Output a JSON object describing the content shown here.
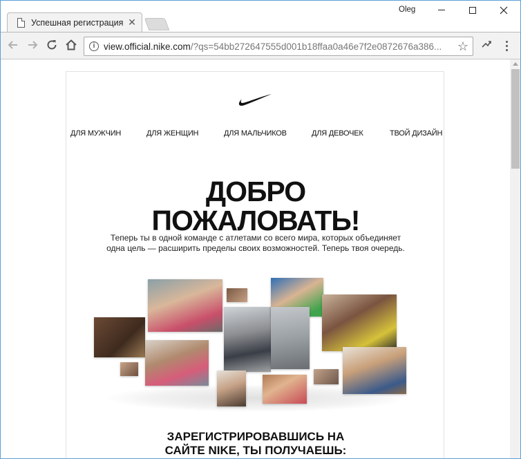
{
  "browser": {
    "tab_title": "Успешная регистрация",
    "tab_close": "✕",
    "profile_name": "Oleg",
    "url_host": "view.official.nike.com",
    "url_rest": "/?qs=54bb272647555d001b18ffaa0a46e7f2e0872676a386...",
    "icons": {
      "back": "arrow-left-icon",
      "forward": "arrow-right-icon",
      "reload": "reload-icon",
      "home": "home-icon",
      "info": "info-icon",
      "star": "star-icon",
      "menu": "kebab-menu-icon"
    }
  },
  "email": {
    "nav": [
      "ДЛЯ МУЖЧИН",
      "ДЛЯ ЖЕНЩИН",
      "ДЛЯ МАЛЬЧИКОВ",
      "ДЛЯ ДЕВОЧЕК",
      "ТВОЙ ДИЗАЙН"
    ],
    "headline_line1": "ДОБРО",
    "headline_line2": "ПОЖАЛОВАТЬ!",
    "subtext_line1": "Теперь ты в одной команде с атлетами со всего мира, которых объединяет",
    "subtext_line2": "одна цель — расширить пределы своих возможностей. Теперь твоя очередь.",
    "cta_line1": "ЗАРЕГИСТРИРОВАВШИСЬ НА",
    "cta_line2": "САЙТЕ NIKE, ТЫ ПОЛУЧАЕШЬ:"
  },
  "colors": {
    "accent": "#5c9ed8",
    "text": "#111111",
    "chrome": "#f2f2f2"
  }
}
